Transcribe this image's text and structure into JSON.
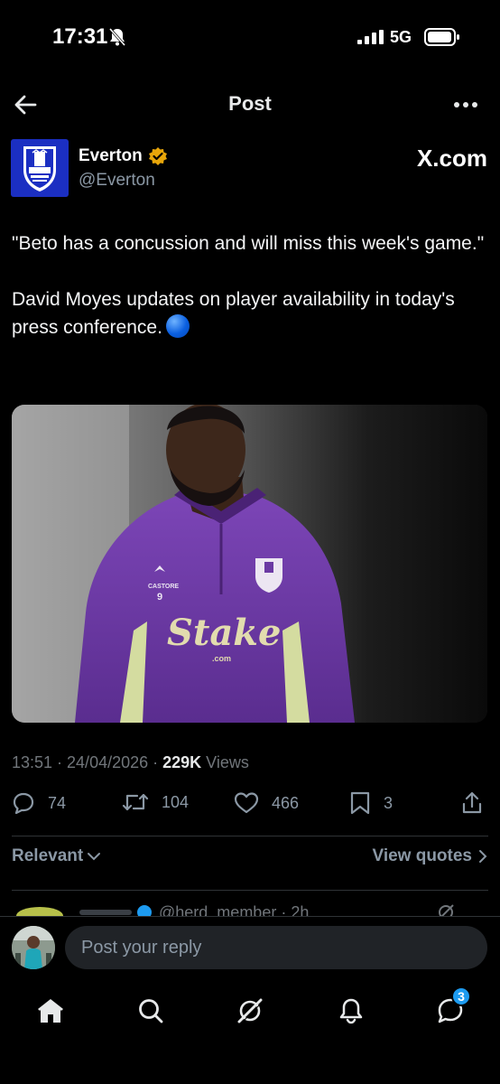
{
  "status_bar": {
    "time": "17:31",
    "network": "5G"
  },
  "header": {
    "title": "Post"
  },
  "author": {
    "name": "Everton",
    "handle": "@Everton",
    "source": "X.com"
  },
  "post": {
    "paragraphs": [
      "\"Beto has a concussion and will miss this week's game.\"",
      "David Moyes updates on player availability in today's press conference."
    ],
    "image_alt": "Player in purple training top",
    "shirt_sponsor": "Stake",
    "shirt_sponsor_sub": ".com",
    "kit_brand": "CASTORE",
    "squad_number": "9",
    "timestamp": "13:51 · 24/04/2026 · ",
    "views_count": "229K",
    "views_label": " Views"
  },
  "actions": {
    "replies": "74",
    "reposts": "104",
    "likes": "466",
    "bookmarks": "3"
  },
  "sort": {
    "left_label": "Relevant",
    "right_label": "View quotes"
  },
  "reply_peek": {
    "handle_text": "@herd_member · 2h"
  },
  "reply_bar": {
    "placeholder": "Post your reply"
  },
  "tabs": {
    "notifications_badge": "3"
  },
  "colors": {
    "accent": "#1d9bf0",
    "verified": "#e8a60a",
    "background": "#000000",
    "muted": "#8b98a5"
  }
}
